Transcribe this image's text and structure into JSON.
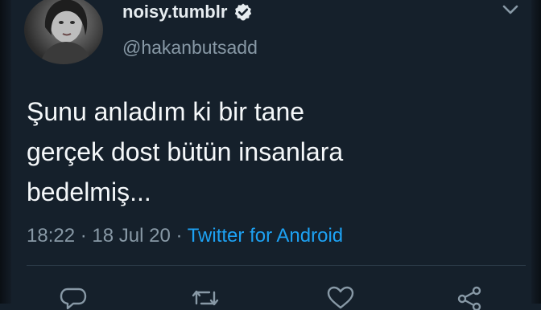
{
  "user": {
    "display_name": "noisy.tumblr",
    "handle": "@hakanbutsadd",
    "verified_icon": "verified-badge-icon",
    "avatar": "profile-photo-avatar"
  },
  "tweet": {
    "lines": [
      "Şunu anladım ki bir tane",
      "gerçek dost bütün insanlara",
      "bedelmiş..."
    ]
  },
  "meta": {
    "time": "18:22",
    "separator": "·",
    "date": "18 Jul 20",
    "source": "Twitter for Android"
  },
  "actions": {
    "icons": [
      "reply-icon",
      "retweet-icon",
      "like-icon",
      "share-icon"
    ]
  },
  "colors": {
    "background": "#15202b",
    "primary_text": "#f5f8fa",
    "secondary_text": "#8899a6",
    "link": "#1da1f2"
  }
}
